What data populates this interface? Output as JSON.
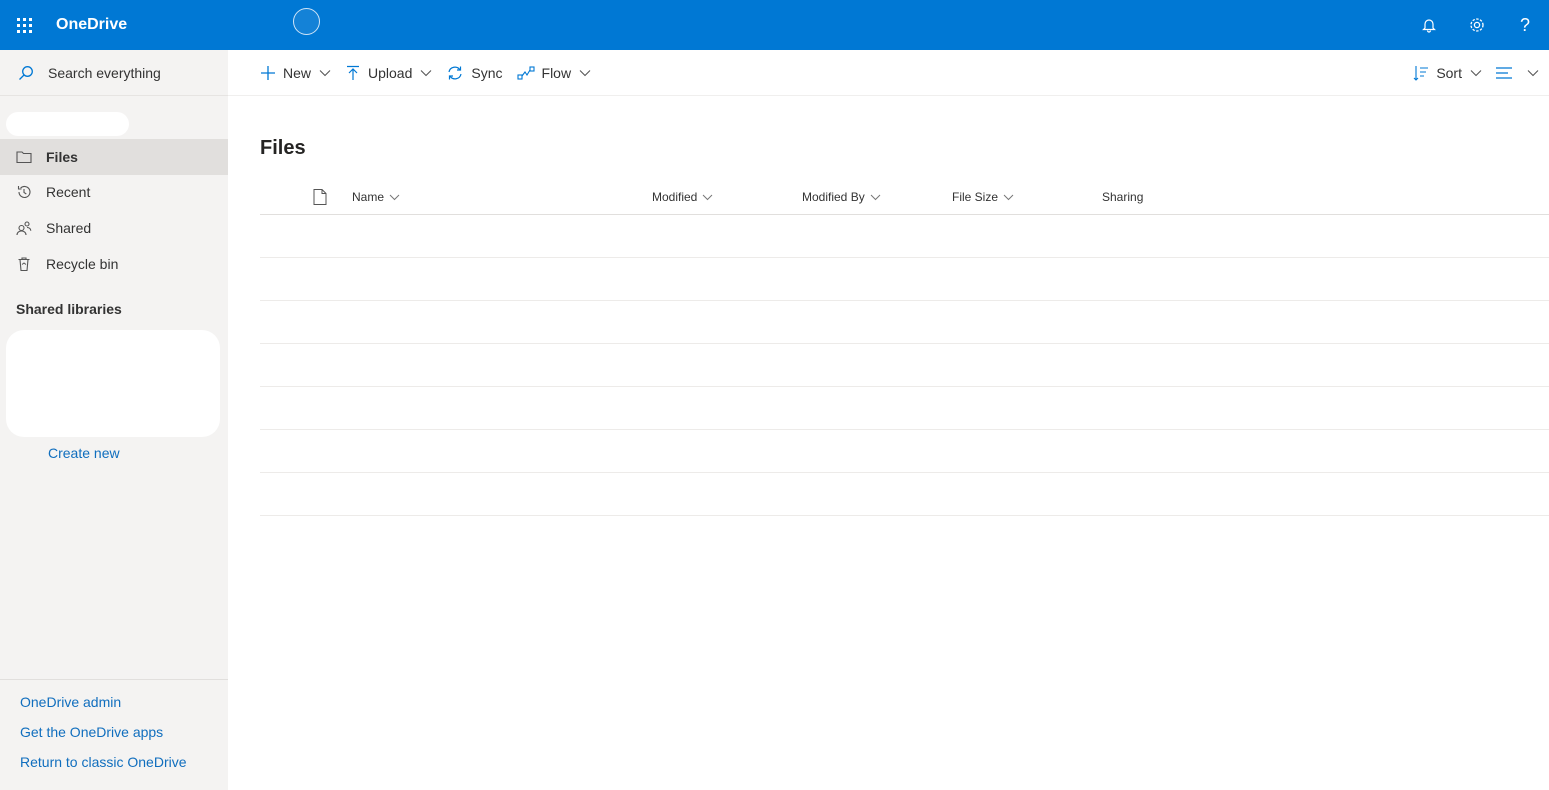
{
  "suitebar": {
    "app_name": "OneDrive",
    "icons": [
      "waffle-icon",
      "bell-icon",
      "gear-icon",
      "help-icon"
    ],
    "help_glyph": "?"
  },
  "leftnav": {
    "search_placeholder": "Search everything",
    "items": [
      {
        "label": "Files",
        "icon": "folder-icon",
        "active": true
      },
      {
        "label": "Recent",
        "icon": "history-icon",
        "active": false
      },
      {
        "label": "Shared",
        "icon": "people-icon",
        "active": false
      },
      {
        "label": "Recycle bin",
        "icon": "trash-icon",
        "active": false
      }
    ],
    "shared_libraries_heading": "Shared libraries",
    "create_new": "Create new",
    "footer_links": [
      "OneDrive admin",
      "Get the OneDrive apps",
      "Return to classic OneDrive"
    ]
  },
  "commandbar": {
    "new": "New",
    "upload": "Upload",
    "sync": "Sync",
    "flow": "Flow",
    "sort": "Sort"
  },
  "main": {
    "title": "Files",
    "columns": [
      "Name",
      "Modified",
      "Modified By",
      "File Size",
      "Sharing"
    ]
  },
  "colors": {
    "suitebar": "#0078d4",
    "link": "#106ebe",
    "nav_bg": "#f4f3f2",
    "nav_active": "#e1dfdd"
  }
}
